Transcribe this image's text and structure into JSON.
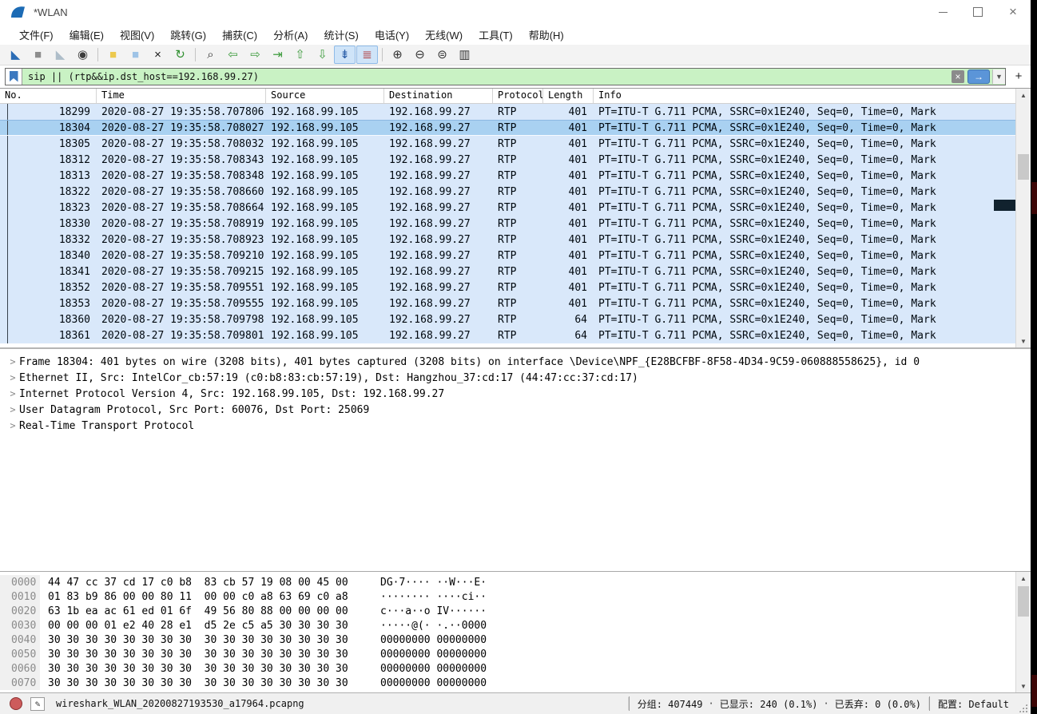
{
  "window": {
    "title": "*WLAN",
    "close_glyph": "×"
  },
  "menu": {
    "items": [
      {
        "label": "文件(F)"
      },
      {
        "label": "编辑(E)"
      },
      {
        "label": "视图(V)"
      },
      {
        "label": "跳转(G)"
      },
      {
        "label": "捕获(C)"
      },
      {
        "label": "分析(A)"
      },
      {
        "label": "统计(S)"
      },
      {
        "label": "电话(Y)"
      },
      {
        "label": "无线(W)"
      },
      {
        "label": "工具(T)"
      },
      {
        "label": "帮助(H)"
      }
    ]
  },
  "toolbar": {
    "buttons": [
      {
        "name": "start-capture-icon",
        "glyph": "◣",
        "fg": "#2b6cb5"
      },
      {
        "name": "stop-capture-icon",
        "glyph": "■",
        "fg": "#8d8d8d"
      },
      {
        "name": "restart-capture-icon",
        "glyph": "◣",
        "fg": "#aebdc9"
      },
      {
        "name": "capture-options-icon",
        "glyph": "◉",
        "fg": "#3d3d3d"
      },
      {
        "name": "toolbar-separator",
        "sep": true
      },
      {
        "name": "open-file-icon",
        "glyph": "■",
        "fg": "#ecc94e"
      },
      {
        "name": "save-file-icon",
        "glyph": "■",
        "fg": "#9ec3e6"
      },
      {
        "name": "close-file-icon",
        "glyph": "×",
        "fg": "#1a1a1a"
      },
      {
        "name": "reload-file-icon",
        "glyph": "↻",
        "fg": "#2f8f2f"
      },
      {
        "name": "toolbar-separator",
        "sep": true
      },
      {
        "name": "find-icon",
        "glyph": "⌕",
        "fg": "#333333"
      },
      {
        "name": "go-back-icon",
        "glyph": "⇦",
        "fg": "#3f9c3f"
      },
      {
        "name": "go-forward-icon",
        "glyph": "⇨",
        "fg": "#3f9c3f"
      },
      {
        "name": "go-to-packet-icon",
        "glyph": "⇥",
        "fg": "#3f9c3f"
      },
      {
        "name": "go-top-icon",
        "glyph": "⇧",
        "fg": "#3f9c3f"
      },
      {
        "name": "go-bottom-icon",
        "glyph": "⇩",
        "fg": "#3f9c3f"
      },
      {
        "name": "auto-scroll-icon",
        "glyph": "⇟",
        "fg": "#2b5fa8",
        "active": true
      },
      {
        "name": "colorize-icon",
        "glyph": "≣",
        "fg": "#b03838",
        "active": true
      },
      {
        "name": "toolbar-separator",
        "sep": true
      },
      {
        "name": "zoom-in-icon",
        "glyph": "⊕",
        "fg": "#333333"
      },
      {
        "name": "zoom-out-icon",
        "glyph": "⊖",
        "fg": "#333333"
      },
      {
        "name": "zoom-normal-icon",
        "glyph": "⊜",
        "fg": "#333333"
      },
      {
        "name": "resize-columns-icon",
        "glyph": "▥",
        "fg": "#333333"
      }
    ]
  },
  "filter": {
    "value": "sip || (rtp&&ip.dst_host==192.168.99.27)",
    "clear_glyph": "×",
    "apply_glyph": "→",
    "caret_glyph": "▼",
    "add_glyph": "+"
  },
  "packet_list": {
    "columns": [
      {
        "label": "No."
      },
      {
        "label": "Time"
      },
      {
        "label": "Source"
      },
      {
        "label": "Destination"
      },
      {
        "label": "Protocol"
      },
      {
        "label": "Length"
      },
      {
        "label": "Info"
      }
    ],
    "rows": [
      {
        "no": "18299",
        "time": "2020-08-27 19:35:58.707806",
        "source": "192.168.99.105",
        "destination": "192.168.99.27",
        "protocol": "RTP",
        "length": "401",
        "info": "PT=ITU-T G.711 PCMA, SSRC=0x1E240, Seq=0, Time=0, Mark"
      },
      {
        "no": "18304",
        "time": "2020-08-27 19:35:58.708027",
        "source": "192.168.99.105",
        "destination": "192.168.99.27",
        "protocol": "RTP",
        "length": "401",
        "info": "PT=ITU-T G.711 PCMA, SSRC=0x1E240, Seq=0, Time=0, Mark",
        "selected": true
      },
      {
        "no": "18305",
        "time": "2020-08-27 19:35:58.708032",
        "source": "192.168.99.105",
        "destination": "192.168.99.27",
        "protocol": "RTP",
        "length": "401",
        "info": "PT=ITU-T G.711 PCMA, SSRC=0x1E240, Seq=0, Time=0, Mark"
      },
      {
        "no": "18312",
        "time": "2020-08-27 19:35:58.708343",
        "source": "192.168.99.105",
        "destination": "192.168.99.27",
        "protocol": "RTP",
        "length": "401",
        "info": "PT=ITU-T G.711 PCMA, SSRC=0x1E240, Seq=0, Time=0, Mark"
      },
      {
        "no": "18313",
        "time": "2020-08-27 19:35:58.708348",
        "source": "192.168.99.105",
        "destination": "192.168.99.27",
        "protocol": "RTP",
        "length": "401",
        "info": "PT=ITU-T G.711 PCMA, SSRC=0x1E240, Seq=0, Time=0, Mark"
      },
      {
        "no": "18322",
        "time": "2020-08-27 19:35:58.708660",
        "source": "192.168.99.105",
        "destination": "192.168.99.27",
        "protocol": "RTP",
        "length": "401",
        "info": "PT=ITU-T G.711 PCMA, SSRC=0x1E240, Seq=0, Time=0, Mark"
      },
      {
        "no": "18323",
        "time": "2020-08-27 19:35:58.708664",
        "source": "192.168.99.105",
        "destination": "192.168.99.27",
        "protocol": "RTP",
        "length": "401",
        "info": "PT=ITU-T G.711 PCMA, SSRC=0x1E240, Seq=0, Time=0, Mark"
      },
      {
        "no": "18330",
        "time": "2020-08-27 19:35:58.708919",
        "source": "192.168.99.105",
        "destination": "192.168.99.27",
        "protocol": "RTP",
        "length": "401",
        "info": "PT=ITU-T G.711 PCMA, SSRC=0x1E240, Seq=0, Time=0, Mark"
      },
      {
        "no": "18332",
        "time": "2020-08-27 19:35:58.708923",
        "source": "192.168.99.105",
        "destination": "192.168.99.27",
        "protocol": "RTP",
        "length": "401",
        "info": "PT=ITU-T G.711 PCMA, SSRC=0x1E240, Seq=0, Time=0, Mark"
      },
      {
        "no": "18340",
        "time": "2020-08-27 19:35:58.709210",
        "source": "192.168.99.105",
        "destination": "192.168.99.27",
        "protocol": "RTP",
        "length": "401",
        "info": "PT=ITU-T G.711 PCMA, SSRC=0x1E240, Seq=0, Time=0, Mark"
      },
      {
        "no": "18341",
        "time": "2020-08-27 19:35:58.709215",
        "source": "192.168.99.105",
        "destination": "192.168.99.27",
        "protocol": "RTP",
        "length": "401",
        "info": "PT=ITU-T G.711 PCMA, SSRC=0x1E240, Seq=0, Time=0, Mark"
      },
      {
        "no": "18352",
        "time": "2020-08-27 19:35:58.709551",
        "source": "192.168.99.105",
        "destination": "192.168.99.27",
        "protocol": "RTP",
        "length": "401",
        "info": "PT=ITU-T G.711 PCMA, SSRC=0x1E240, Seq=0, Time=0, Mark"
      },
      {
        "no": "18353",
        "time": "2020-08-27 19:35:58.709555",
        "source": "192.168.99.105",
        "destination": "192.168.99.27",
        "protocol": "RTP",
        "length": "401",
        "info": "PT=ITU-T G.711 PCMA, SSRC=0x1E240, Seq=0, Time=0, Mark"
      },
      {
        "no": "18360",
        "time": "2020-08-27 19:35:58.709798",
        "source": "192.168.99.105",
        "destination": "192.168.99.27",
        "protocol": "RTP",
        "length": "64",
        "info": "PT=ITU-T G.711 PCMA, SSRC=0x1E240, Seq=0, Time=0, Mark"
      },
      {
        "no": "18361",
        "time": "2020-08-27 19:35:58.709801",
        "source": "192.168.99.105",
        "destination": "192.168.99.27",
        "protocol": "RTP",
        "length": "64",
        "info": "PT=ITU-T G.711 PCMA, SSRC=0x1E240, Seq=0, Time=0, Mark"
      }
    ]
  },
  "details": {
    "expander_glyph": ">",
    "rows": [
      {
        "text": "Frame 18304: 401 bytes on wire (3208 bits), 401 bytes captured (3208 bits) on interface \\Device\\NPF_{E28BCFBF-8F58-4D34-9C59-060888558625}, id 0"
      },
      {
        "text": "Ethernet II, Src: IntelCor_cb:57:19 (c0:b8:83:cb:57:19), Dst: Hangzhou_37:cd:17 (44:47:cc:37:cd:17)"
      },
      {
        "text": "Internet Protocol Version 4, Src: 192.168.99.105, Dst: 192.168.99.27"
      },
      {
        "text": "User Datagram Protocol, Src Port: 60076, Dst Port: 25069"
      },
      {
        "text": "Real-Time Transport Protocol"
      }
    ]
  },
  "hex": {
    "rows": [
      {
        "offset": "0000",
        "bytes": "44 47 cc 37 cd 17 c0 b8  83 cb 57 19 08 00 45 00",
        "ascii": "DG·7···· ··W···E·"
      },
      {
        "offset": "0010",
        "bytes": "01 83 b9 86 00 00 80 11  00 00 c0 a8 63 69 c0 a8",
        "ascii": "········ ····ci··"
      },
      {
        "offset": "0020",
        "bytes": "63 1b ea ac 61 ed 01 6f  49 56 80 88 00 00 00 00",
        "ascii": "c···a··o IV······"
      },
      {
        "offset": "0030",
        "bytes": "00 00 00 01 e2 40 28 e1  d5 2e c5 a5 30 30 30 30",
        "ascii": "·····@(· ·.··0000"
      },
      {
        "offset": "0040",
        "bytes": "30 30 30 30 30 30 30 30  30 30 30 30 30 30 30 30",
        "ascii": "00000000 00000000"
      },
      {
        "offset": "0050",
        "bytes": "30 30 30 30 30 30 30 30  30 30 30 30 30 30 30 30",
        "ascii": "00000000 00000000"
      },
      {
        "offset": "0060",
        "bytes": "30 30 30 30 30 30 30 30  30 30 30 30 30 30 30 30",
        "ascii": "00000000 00000000"
      },
      {
        "offset": "0070",
        "bytes": "30 30 30 30 30 30 30 30  30 30 30 30 30 30 30 30",
        "ascii": "00000000 00000000"
      }
    ]
  },
  "statusbar": {
    "comment_glyph": "✎",
    "filename": "wireshark_WLAN_20200827193530_a17964.pcapng",
    "packets_label": "分组: 407449",
    "separator_dot": "·",
    "displayed_label": "已显示: 240 (0.1%)",
    "dropped_label": "已丢弃: 0 (0.0%)",
    "profile_label": "配置: Default"
  }
}
